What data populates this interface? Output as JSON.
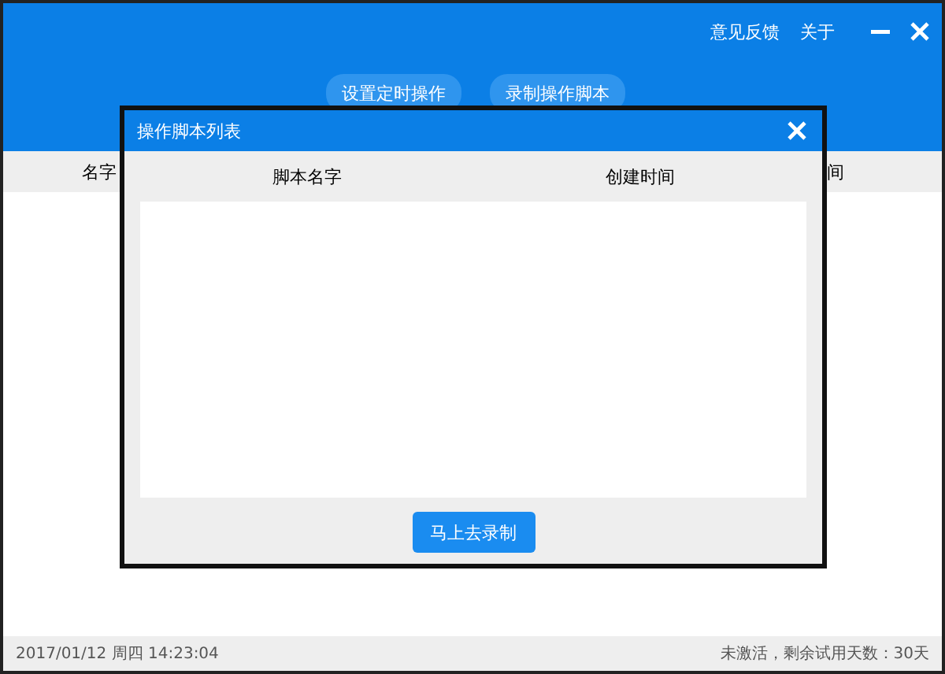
{
  "header": {
    "links": [
      "意见反馈",
      "关于"
    ],
    "buttons": [
      "设置定时操作",
      "录制操作脚本"
    ]
  },
  "table": {
    "columns": [
      "名字",
      "间"
    ]
  },
  "status_bar": {
    "datetime": "2017/01/12 周四 14:23:04",
    "trial": "未激活，剩余试用天数：30天"
  },
  "dialog": {
    "title": "操作脚本列表",
    "columns": [
      "脚本名字",
      "创建时间"
    ],
    "button": "马上去录制"
  }
}
